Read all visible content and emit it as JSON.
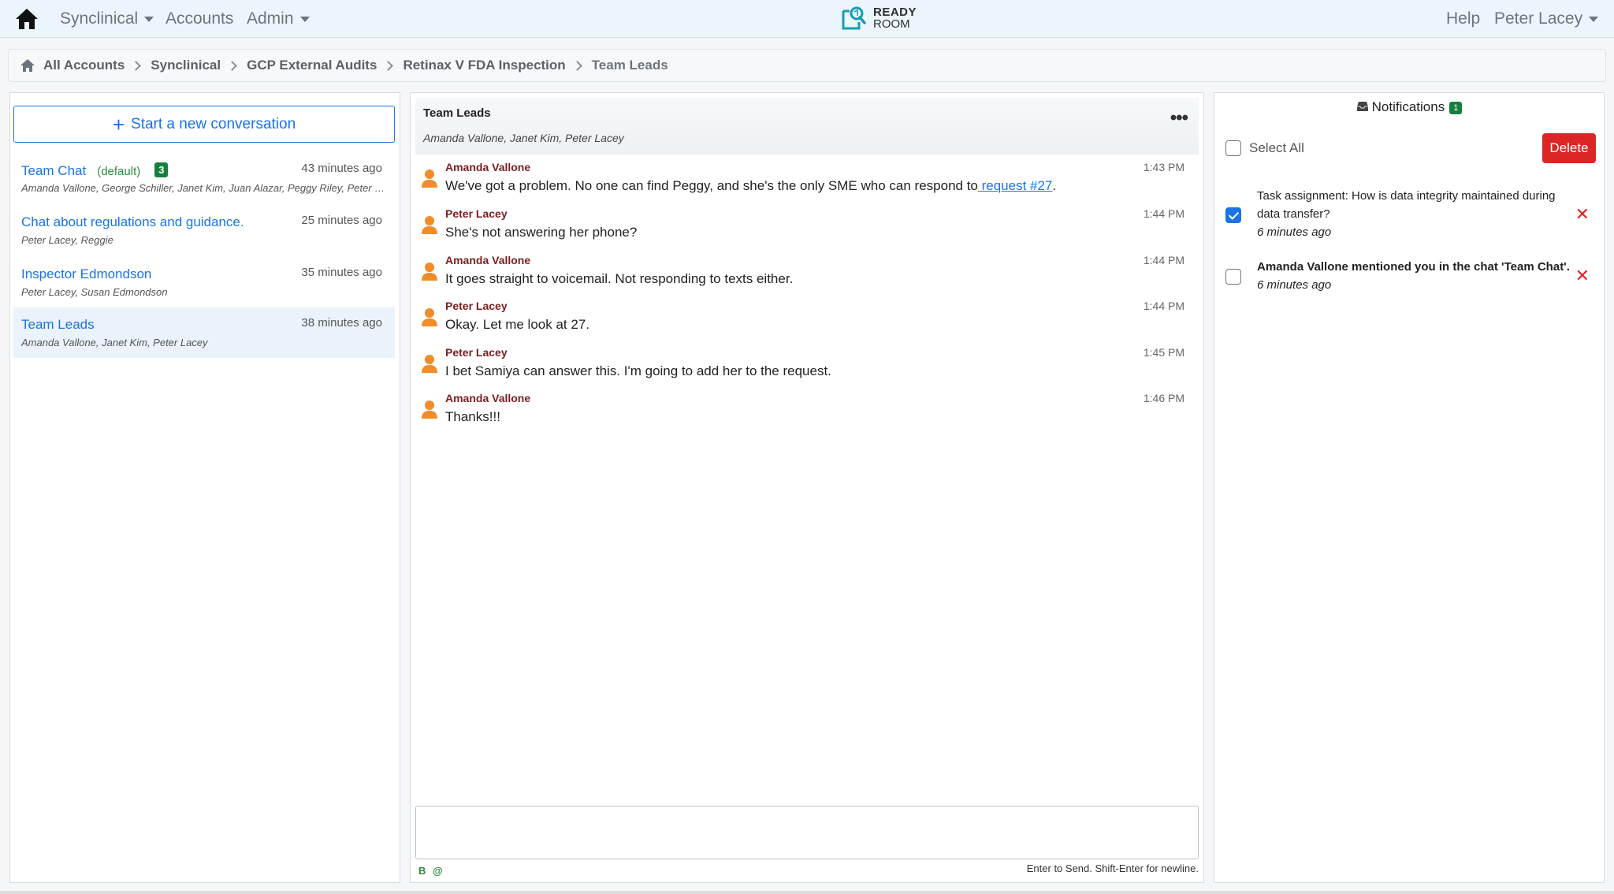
{
  "navbar": {
    "menu_synclinical": "Synclinical",
    "menu_accounts": "Accounts",
    "menu_admin": "Admin",
    "brand_line1": "READY",
    "brand_line2": "ROOM",
    "help": "Help",
    "user": "Peter Lacey"
  },
  "breadcrumb": [
    "All Accounts",
    "Synclinical",
    "GCP External Audits",
    "Retinax V FDA Inspection",
    "Team Leads"
  ],
  "conversations": {
    "new_label": "Start a new conversation",
    "items": [
      {
        "title": "Team Chat",
        "default_label": "(default)",
        "badge": "3",
        "time": "43 minutes ago",
        "members": "Amanda Vallone, George Schiller, Janet Kim, Juan Alazar, Peggy Riley, Peter Lacey"
      },
      {
        "title": "Chat about regulations and guidance.",
        "time": "25 minutes ago",
        "members": "Peter Lacey, Reggie"
      },
      {
        "title": "Inspector Edmondson",
        "time": "35 minutes ago",
        "members": "Peter Lacey, Susan Edmondson"
      },
      {
        "title": "Team Leads",
        "time": "38 minutes ago",
        "members": "Amanda Vallone, Janet Kim, Peter Lacey"
      }
    ]
  },
  "chat": {
    "title": "Team Leads",
    "members": "Amanda Vallone, Janet Kim, Peter Lacey",
    "more": "•••",
    "messages": [
      {
        "author": "Amanda Vallone",
        "time": "1:43 PM",
        "text": "We've got a problem. No one can find Peggy, and she's the only SME who can respond to",
        "link": " request #27",
        "after": "."
      },
      {
        "author": "Peter Lacey",
        "time": "1:44 PM",
        "text": "She's not answering her phone?"
      },
      {
        "author": "Amanda Vallone",
        "time": "1:44 PM",
        "text": "It goes straight to voicemail. Not responding to texts either."
      },
      {
        "author": "Peter Lacey",
        "time": "1:44 PM",
        "text": "Okay. Let me look at 27."
      },
      {
        "author": "Peter Lacey",
        "time": "1:45 PM",
        "text": "I bet Samiya can answer this. I'm going to add her to the request."
      },
      {
        "author": "Amanda Vallone",
        "time": "1:46 PM",
        "text": "Thanks!!!"
      }
    ],
    "bold_btn": "B",
    "mention_btn": "@",
    "hint": "Enter to Send. Shift-Enter for newline."
  },
  "notifications": {
    "title": "Notifications",
    "count": "1",
    "select_all": "Select All",
    "delete": "Delete",
    "items": [
      {
        "text": "Task assignment: How is data integrity maintained during data transfer?",
        "time": "6 minutes ago",
        "checked": true,
        "bold": false
      },
      {
        "text": "Amanda Vallone mentioned you in the chat 'Team Chat'.",
        "time": "6 minutes ago",
        "checked": false,
        "bold": true
      }
    ]
  },
  "colors": {
    "accent": "#1a73e8",
    "danger": "#dc2626",
    "badge": "#15803d",
    "author": "#7b1f1f",
    "avatar": "#f28c28"
  }
}
